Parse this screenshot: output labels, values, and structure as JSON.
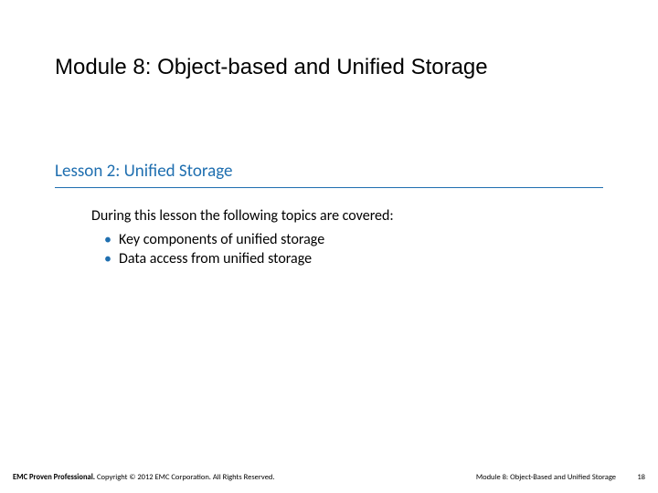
{
  "title": "Module 8: Object-based and Unified Storage",
  "subtitle": "Lesson 2: Unified Storage",
  "body": {
    "intro": "During this lesson the following topics are covered:",
    "bullets": [
      "Key components of unified storage",
      "Data access from unified storage"
    ]
  },
  "footer": {
    "left_bold": "EMC Proven Professional.",
    "left_rest": " Copyright © 2012 EMC Corporation. All Rights Reserved.",
    "mid": "Module 8: Object-Based and Unified Storage",
    "page": "18"
  },
  "colors": {
    "accent": "#1f6fb0"
  }
}
